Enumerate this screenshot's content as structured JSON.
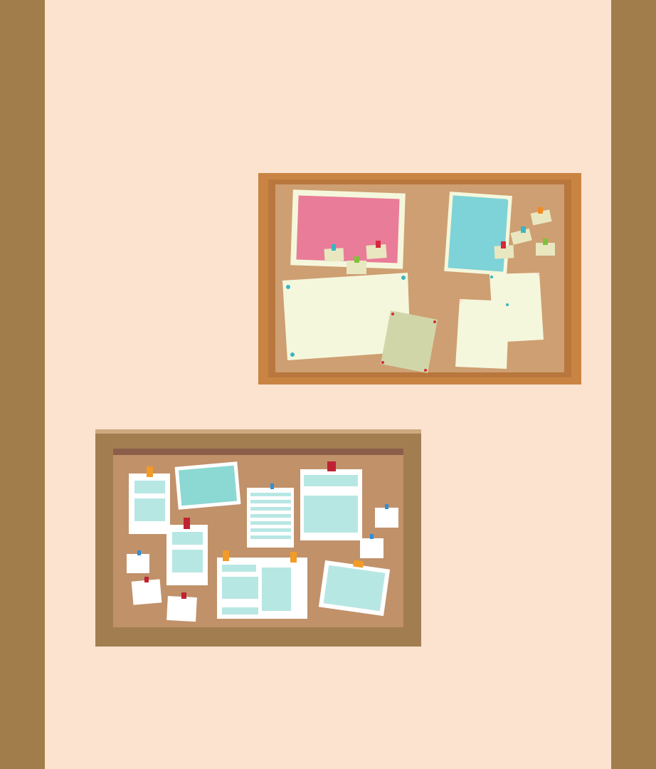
{
  "scene": {
    "subject": "corkboards",
    "colors": {
      "wall": "#FBE3D0",
      "pillar": "#A27D4C",
      "board1_frame": "#C98443",
      "board1_frame_inner": "#B9773D",
      "board1_cork": "#CE9F72",
      "board2_frame": "#A27D50",
      "board2_frame_top": "#CFA880",
      "board2_strip": "#8B5E4A",
      "board2_cork": "#C1916A",
      "paper_cream": "#F5F7DC",
      "note_cream": "#E8E7C0",
      "photo_pink": "#E97C98",
      "photo_cyan": "#7DD3D7",
      "note_olive": "#D1D6A9",
      "paper_white": "#FFFFFF",
      "panel_teal": "#B7E7E3",
      "photo_teal": "#8CD8D2",
      "pin_teal": "#38B6C2",
      "pin_green": "#7EC23A",
      "pin_red": "#D5283E",
      "pin_orange": "#F08B22",
      "pin_blue": "#2F8FD8",
      "tape_orange": "#F39B27",
      "tape_red": "#BF2233"
    }
  }
}
